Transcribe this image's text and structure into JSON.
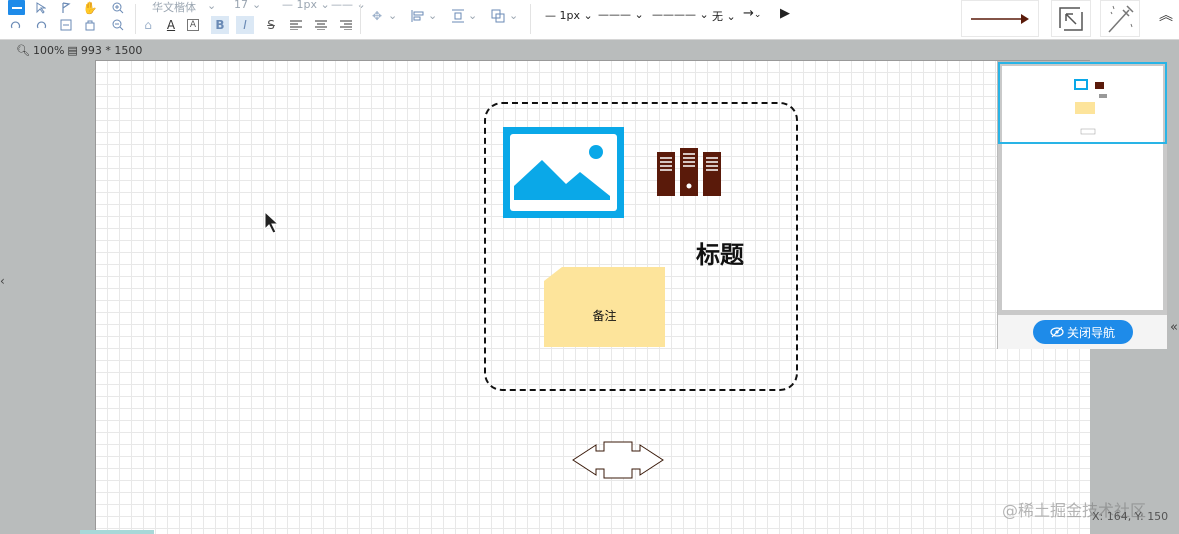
{
  "toolbar": {
    "font_family": "华文楷体",
    "font_size": "17",
    "line_width_1": "1px",
    "line_width_2": "1px",
    "bold_label": "B",
    "italic_label": "I",
    "text_color_label": "A",
    "text_bg_label": "A",
    "strike_label": "S",
    "line_style_label": "1px",
    "none_label": "无",
    "icons": [
      "select-icon",
      "pointer-icon",
      "flag-pointer-icon",
      "hand-icon",
      "zoom-in-icon",
      "undo-icon",
      "redo-icon",
      "delete-icon",
      "clear-icon",
      "zoom-out-icon"
    ]
  },
  "status": {
    "zoom": "100%",
    "page_size": "993 * 1500"
  },
  "canvas": {
    "title_text": "标题",
    "note_text": "备注"
  },
  "navigator": {
    "close_label": "关闭导航"
  },
  "coords": "X: 164, Y: 150",
  "watermark": "@稀土掘金技术社区",
  "colors": {
    "accent": "#1e8be9",
    "image_blue": "#0aa8e8",
    "server_brown": "#5a1a0a",
    "note_yellow": "#fde49b",
    "viewport": "#29b4e6"
  }
}
